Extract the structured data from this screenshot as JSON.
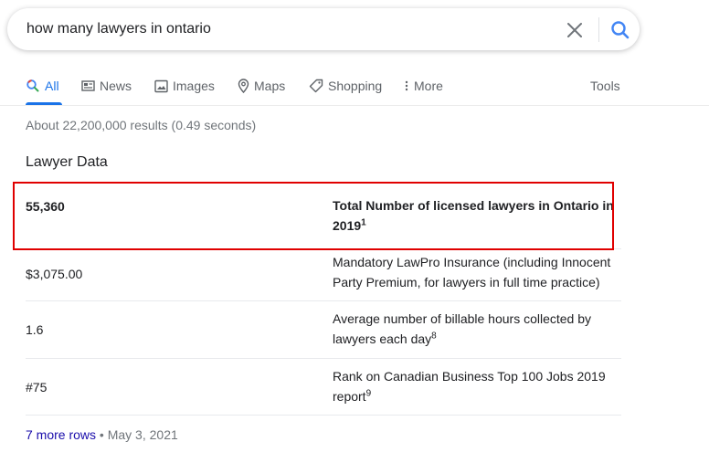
{
  "search": {
    "query": "how many lawyers in ontario"
  },
  "tabs": [
    {
      "label": "All",
      "icon": "search-icon",
      "active": true
    },
    {
      "label": "News",
      "icon": "news-icon"
    },
    {
      "label": "Images",
      "icon": "images-icon"
    },
    {
      "label": "Maps",
      "icon": "maps-pin-icon"
    },
    {
      "label": "Shopping",
      "icon": "tag-icon"
    },
    {
      "label": "More",
      "icon": "more-vert-icon"
    }
  ],
  "tools_label": "Tools",
  "result_stats": "About 22,200,000 results (0.49 seconds)",
  "section_title": "Lawyer Data",
  "table": {
    "rows": [
      {
        "value": "55,360",
        "desc": "Total Number of licensed lawyers in Ontario in 2019",
        "sup": "1"
      },
      {
        "value": "$3,075.00",
        "desc": "Mandatory LawPro Insurance (including Innocent Party Premium, for lawyers in full time practice)",
        "sup": ""
      },
      {
        "value": "1.6",
        "desc": "Average number of billable hours collected by lawyers each day",
        "sup": "8"
      },
      {
        "value": "#75",
        "desc": "Rank on Canadian Business Top 100 Jobs 2019 report",
        "sup": "9"
      }
    ]
  },
  "footer": {
    "more_rows": "7 more rows",
    "separator": "•",
    "date": "May 3, 2021"
  },
  "colors": {
    "accent": "#1a73e8",
    "highlight": "#e00000",
    "link": "#1a0dab"
  }
}
